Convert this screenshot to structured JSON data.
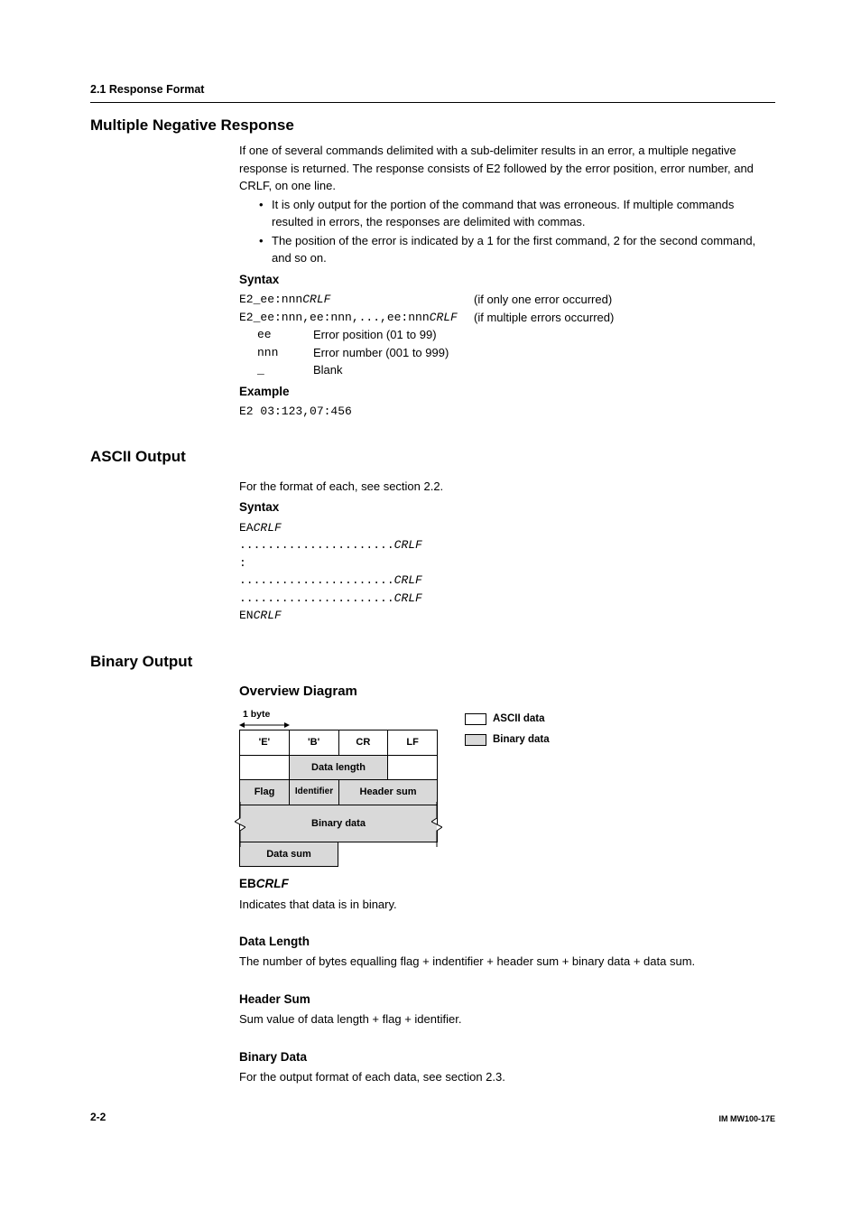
{
  "header": {
    "section": "2.1  Response Format"
  },
  "mnr": {
    "title": "Multiple Negative Response",
    "intro1": "If one of several commands delimited with a sub-delimiter results in an error, a multiple negative response is returned. The response consists of E2 followed by the error position, error number, and CRLF, on one line.",
    "bullet1": "It is only output for the portion of the command that was erroneous. If multiple commands resulted in errors, the responses are delimited with commas.",
    "bullet2": "The position of the error is indicated by a 1 for the first command, 2 for the second command, and so on.",
    "syntax_label": "Syntax",
    "syntax_line1_code": "E2_ee:nnn",
    "crlf": "CRLF",
    "syntax_line1_note": "(if only one error occurred)",
    "syntax_line2_code": "E2_ee:nnn,ee:nnn,...,ee:nnn",
    "syntax_line2_note": "(if multiple errors occurred)",
    "def_ee_term": "ee",
    "def_ee": "Error position (01 to 99)",
    "def_nnn_term": "nnn",
    "def_nnn": "Error number (001 to 999)",
    "def_blank_term": "_",
    "def_blank": "Blank",
    "example_label": "Example",
    "example_code": "E2 03:123,07:456"
  },
  "ascii": {
    "title": "ASCII Output",
    "intro": "For the format of each, see section 2.2.",
    "syntax_label": "Syntax",
    "l1a": "EA",
    "dots": "......................",
    "colon": "   :",
    "l5a": "EN"
  },
  "binary": {
    "title": "Binary Output",
    "overview": "Overview Diagram",
    "byte": "1 byte",
    "c_e": "'E'",
    "c_b": "'B'",
    "c_cr": "CR",
    "c_lf": "LF",
    "data_length": "Data length",
    "flag": "Flag",
    "identifier": "Identifier",
    "header_sum": "Header sum",
    "binary_data": "Binary data",
    "data_sum": "Data sum",
    "legend_ascii": "ASCII data",
    "legend_binary": "Binary data",
    "ebcrlf_prefix": "EB",
    "ebcrlf_suffix": "CRLF",
    "ebcrlf_text": "Indicates that data is in binary.",
    "dl_title": "Data Length",
    "dl_text": "The number of bytes equalling flag + indentifier + header sum + binary data + data sum.",
    "hs_title": "Header Sum",
    "hs_text": "Sum value of data length + flag + identifier.",
    "bd_title": "Binary Data",
    "bd_text": "For the output format of each data, see section 2.3."
  },
  "footer": {
    "page": "2-2",
    "doc": "IM MW100-17E"
  }
}
